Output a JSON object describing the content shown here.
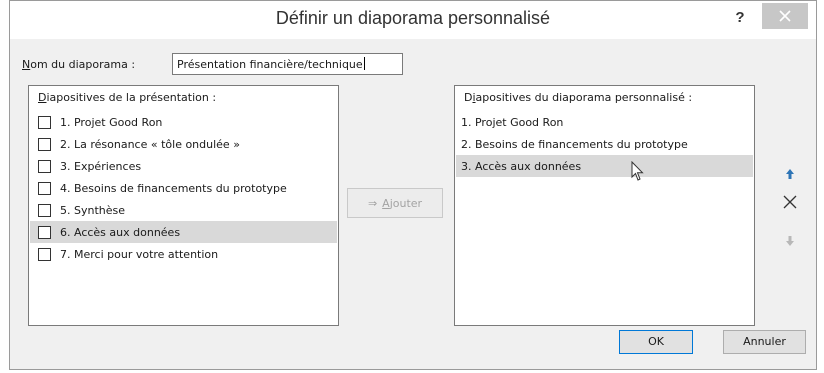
{
  "dialog": {
    "title": "Définir un diaporama personnalisé",
    "help_label": "?",
    "close_icon": "close-icon"
  },
  "name_field": {
    "label_mnemonic": "N",
    "label_rest": "om du diaporama :",
    "value": "Présentation financière/technique"
  },
  "source_list": {
    "title_mnemonic": "D",
    "title_rest": "iapositives de la présentation :",
    "items": [
      {
        "label": "1. Projet  Good Ron",
        "checked": false
      },
      {
        "label": "2. La résonance « tôle ondulée »",
        "checked": false
      },
      {
        "label": "3. Expériences",
        "checked": false
      },
      {
        "label": "4. Besoins de financements du prototype",
        "checked": false
      },
      {
        "label": "5. Synthèse",
        "checked": false
      },
      {
        "label": "6. Accès aux données",
        "checked": false,
        "selected": true
      },
      {
        "label": "7. Merci pour votre attention",
        "checked": false
      }
    ]
  },
  "add_button": {
    "arrow": "⇒",
    "label_mnemonic": "A",
    "label_rest": "jouter",
    "enabled": false
  },
  "target_list": {
    "title_prefix": "D",
    "title_mnemonic": "i",
    "title_rest": "apositives du diaporama personnalisé :",
    "items": [
      {
        "label": "1. Projet  Good Ron"
      },
      {
        "label": "2. Besoins de financements du prototype"
      },
      {
        "label": "3. Accès aux données",
        "selected": true
      }
    ]
  },
  "side_buttons": {
    "up_icon": "arrow-up-icon",
    "remove_icon": "remove-x-icon",
    "down_icon": "arrow-down-icon"
  },
  "footer": {
    "ok_label": "OK",
    "cancel_label": "Annuler"
  },
  "colors": {
    "accent": "#2e75b6",
    "selection": "#d9d9d9",
    "dialog_bg": "#f0f0f0"
  }
}
